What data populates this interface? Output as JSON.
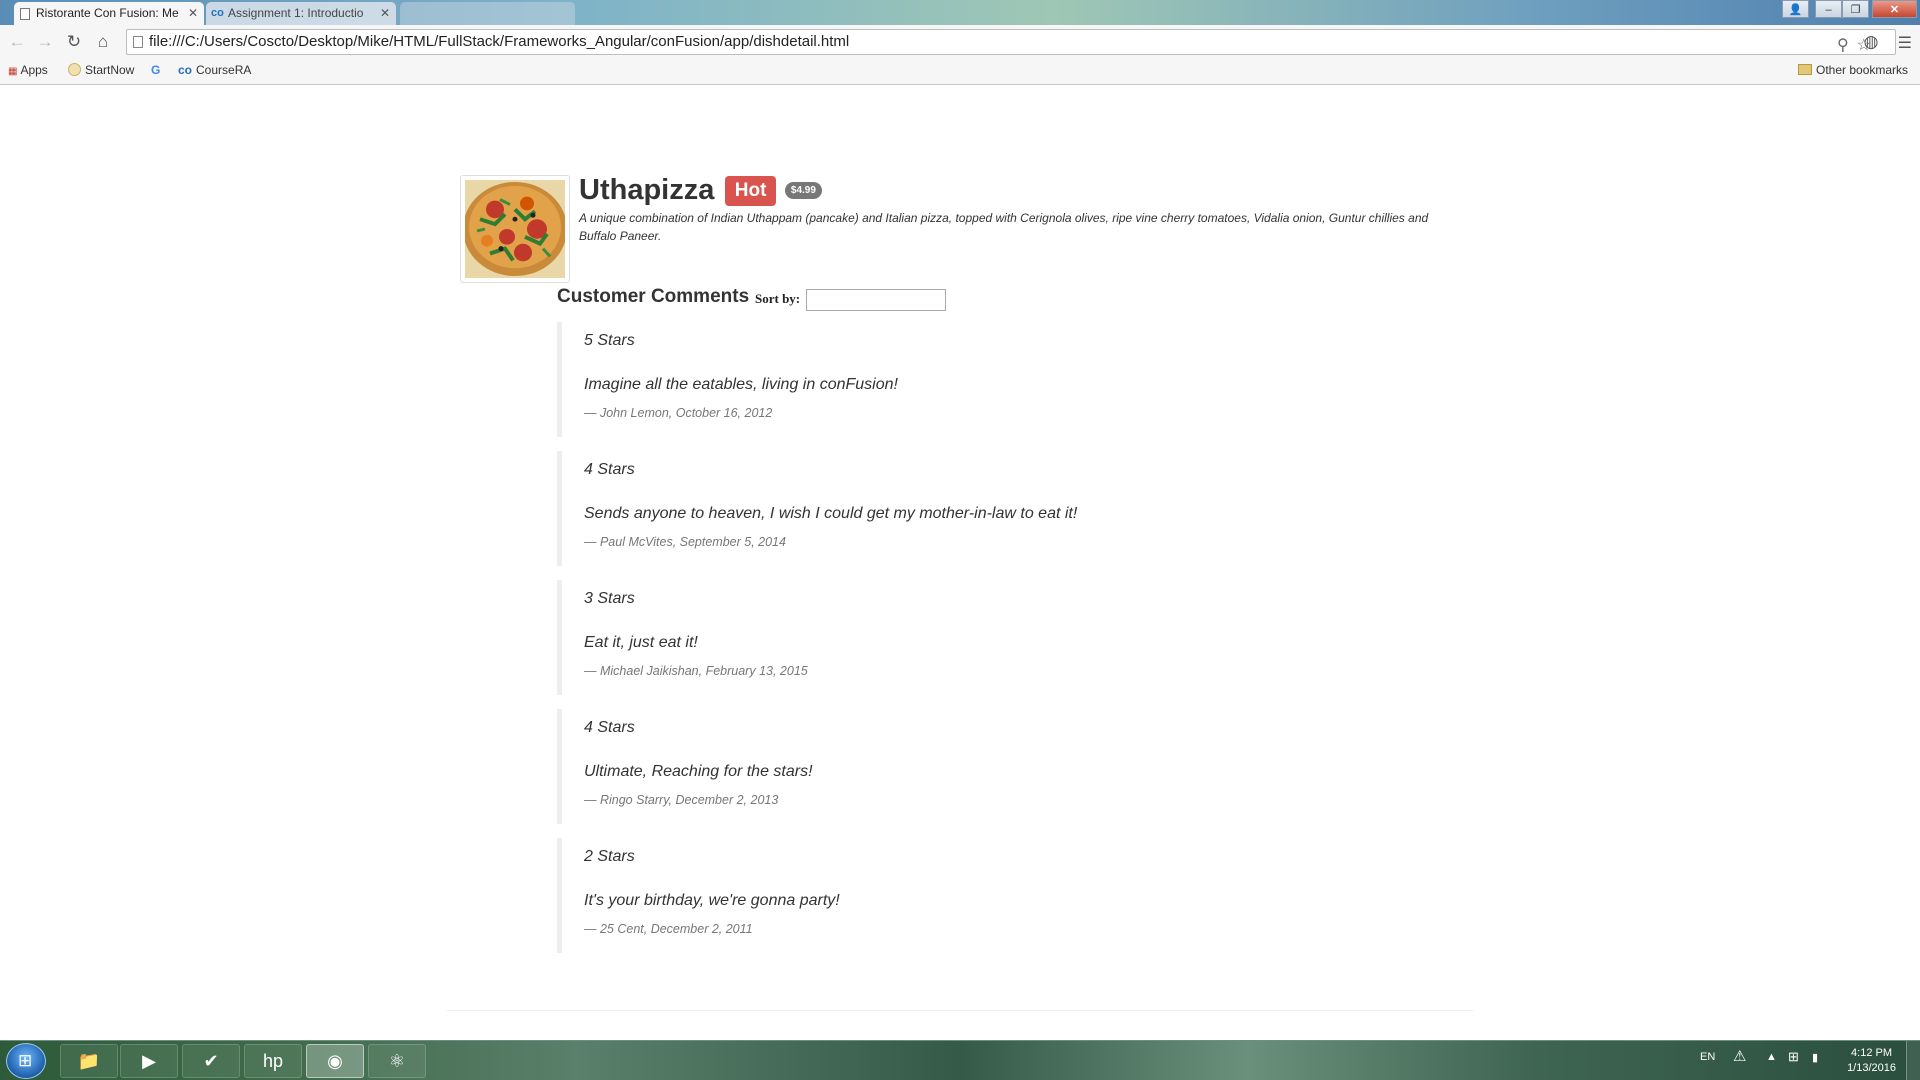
{
  "browser": {
    "tabs": [
      {
        "title": "Ristorante Con Fusion: Me",
        "active": true
      },
      {
        "title": "Assignment 1: Introductio",
        "active": false
      },
      {
        "title": "",
        "active": false
      }
    ],
    "address": "file:///C:/Users/Coscto/Desktop/Mike/HTML/FullStack/Frameworks_Angular/conFusion/app/dishdetail.html",
    "bookmarks": [
      {
        "label": "Apps",
        "icon": "apps-grid-icon"
      },
      {
        "label": "StartNow",
        "icon": "startnow-icon"
      },
      {
        "label": "",
        "icon": "google-icon"
      },
      {
        "label": "CourseRA",
        "icon": "coursera-icon"
      }
    ],
    "other_bookmarks": "Other bookmarks"
  },
  "dish": {
    "name": "Uthapizza",
    "label": "Hot",
    "price": "$4.99",
    "description": "A unique combination of Indian Uthappam (pancake) and Italian pizza, topped with Cerignola olives, ripe vine cherry tomatoes, Vidalia onion, Guntur chillies and Buffalo Paneer."
  },
  "comments_section": {
    "title": "Customer Comments",
    "sort_label": "Sort by:",
    "sort_value": ""
  },
  "comments": [
    {
      "stars": "5 Stars",
      "text": "Imagine all the eatables, living in conFusion!",
      "footer": "— John Lemon, October 16, 2012"
    },
    {
      "stars": "4 Stars",
      "text": "Sends anyone to heaven, I wish I could get my mother-in-law to eat it!",
      "footer": "— Paul McVites, September 5, 2014"
    },
    {
      "stars": "3 Stars",
      "text": "Eat it, just eat it!",
      "footer": "— Michael Jaikishan, February 13, 2015"
    },
    {
      "stars": "4 Stars",
      "text": "Ultimate, Reaching for the stars!",
      "footer": "— Ringo Starry, December 2, 2013"
    },
    {
      "stars": "2 Stars",
      "text": "It's your birthday, we're gonna party!",
      "footer": "— 25 Cent, December 2, 2011"
    }
  ],
  "taskbar": {
    "language": "EN",
    "time": "4:12 PM",
    "date": "1/13/2016",
    "apps": [
      "explorer-folder-icon",
      "media-player-icon",
      "task-check-icon",
      "hp-icon",
      "chrome-icon",
      "atom-icon"
    ]
  },
  "colors": {
    "hot_label": "#d9534f",
    "price_badge": "#777777",
    "comment_border": "#eeeeee"
  }
}
